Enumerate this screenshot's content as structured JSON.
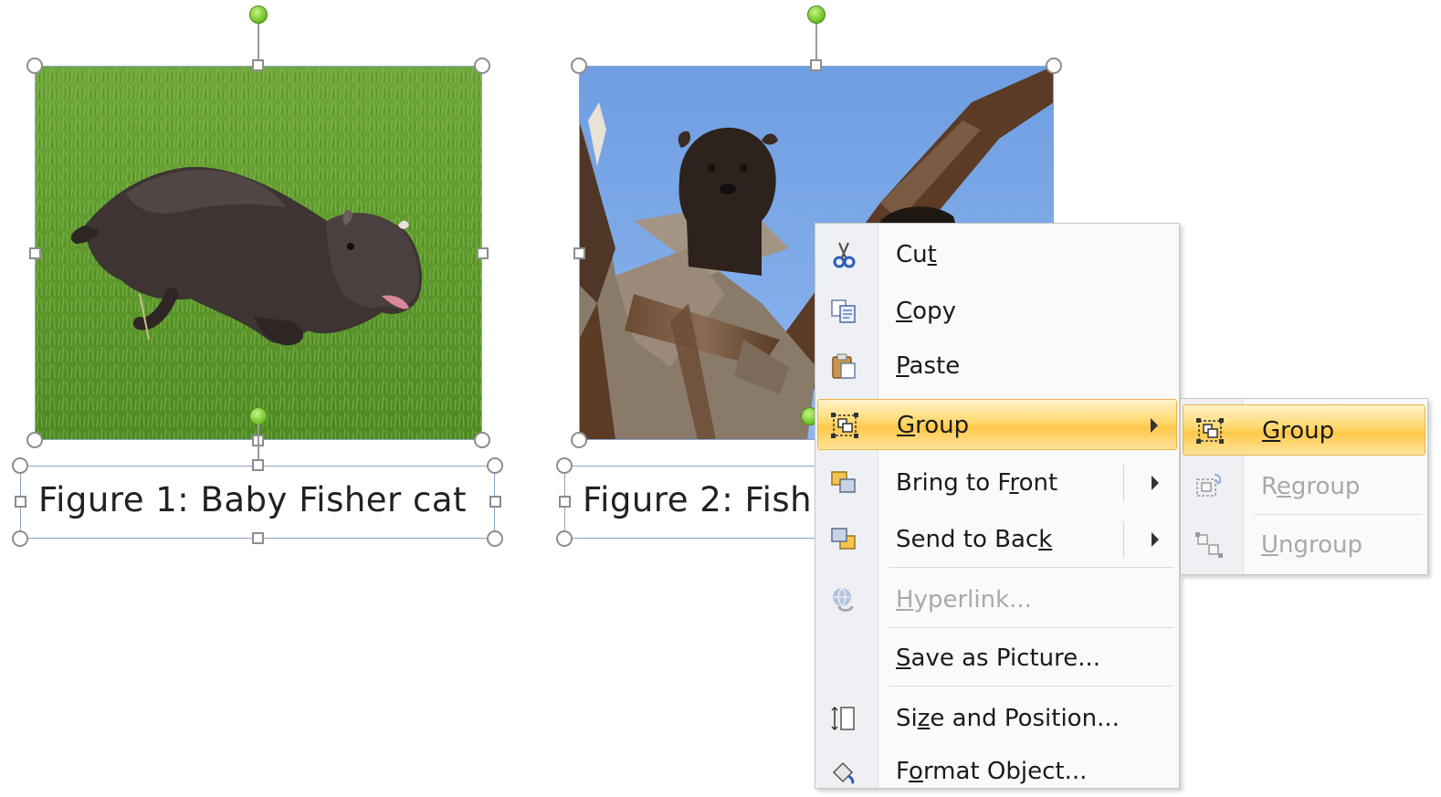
{
  "figures": [
    {
      "caption": "Figure 1:  Baby Fisher cat"
    },
    {
      "caption": "Figure 2: Fish"
    }
  ],
  "context_menu": {
    "items": [
      {
        "pre": "Cu",
        "key": "t",
        "post": "",
        "icon": "scissors-icon",
        "enabled": true
      },
      {
        "pre": "",
        "key": "C",
        "post": "opy",
        "icon": "copy-icon",
        "enabled": true
      },
      {
        "pre": "",
        "key": "P",
        "post": "aste",
        "icon": "paste-icon",
        "enabled": true
      },
      {
        "pre": "",
        "key": "G",
        "post": "roup",
        "icon": "group-icon",
        "enabled": true,
        "highlighted": true,
        "submenu": true
      },
      {
        "pre": "Bring to F",
        "key": "r",
        "post": "ont",
        "icon": "bring-to-front-icon",
        "enabled": true,
        "submenu": true
      },
      {
        "pre": "Send to Bac",
        "key": "k",
        "post": "",
        "icon": "send-to-back-icon",
        "enabled": true,
        "submenu": true
      },
      {
        "pre": "",
        "key": "H",
        "post": "yperlink...",
        "icon": "hyperlink-icon",
        "enabled": false
      },
      {
        "pre": "",
        "key": "S",
        "post": "ave as Picture...",
        "icon": "",
        "enabled": true
      },
      {
        "pre": "Si",
        "key": "z",
        "post": "e and Position...",
        "icon": "size-position-icon",
        "enabled": true
      },
      {
        "pre": "F",
        "key": "o",
        "post": "rmat Object...",
        "icon": "format-object-icon",
        "enabled": true
      }
    ]
  },
  "group_submenu": {
    "items": [
      {
        "pre": "",
        "key": "G",
        "post": "roup",
        "icon": "group-icon",
        "enabled": true,
        "highlighted": true
      },
      {
        "pre": "R",
        "key": "e",
        "post": "group",
        "icon": "regroup-icon",
        "enabled": false
      },
      {
        "pre": "",
        "key": "U",
        "post": "ngroup",
        "icon": "ungroup-icon",
        "enabled": false
      }
    ]
  },
  "colors": {
    "menu_highlight": "#ffd86d",
    "rotation_handle": "#74c52a",
    "selection_border": "#8aa6c8"
  }
}
